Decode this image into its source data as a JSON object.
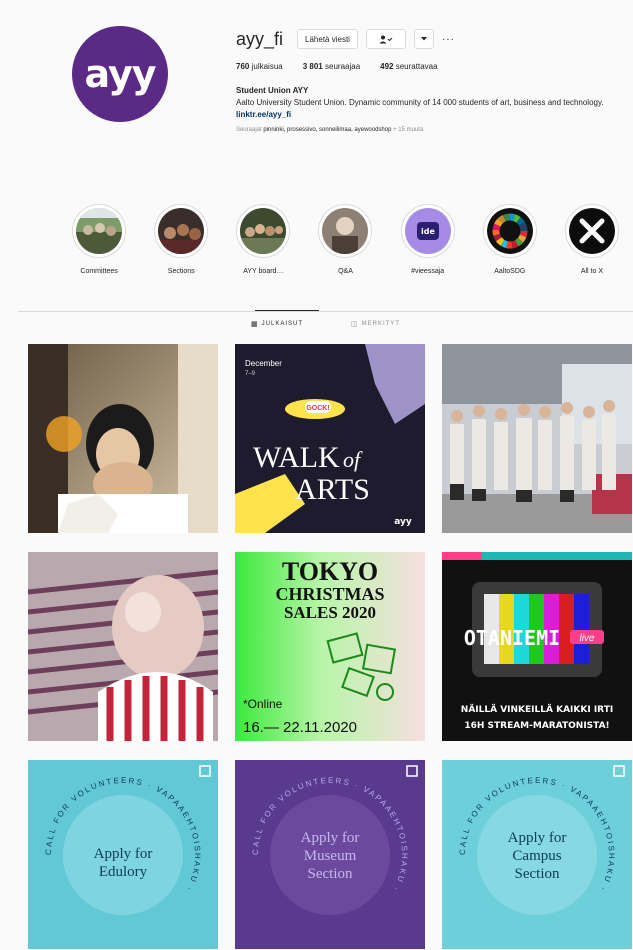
{
  "profile": {
    "username": "ayy_fi",
    "avatar_text": "ayy",
    "message_button": "Lähetä viesti",
    "follow_icon": "person-check-icon",
    "dropdown_icon": "chevron-down-icon",
    "more_icon": "ellipsis-icon",
    "more_label": "···",
    "stats": [
      {
        "value": "760",
        "label": "julkaisua"
      },
      {
        "value": "3 801",
        "label": "seuraajaa"
      },
      {
        "value": "492",
        "label": "seurattavaa"
      }
    ],
    "full_name": "Student Union AYY",
    "bio": "Aalto University Student Union. Dynamic community of 14 000 students of art, business and technology.",
    "link": "linktr.ee/ayy_fi",
    "followed_by_prefix": "Seuraajat",
    "followed_by_names": "pinninki, prosessivo, sonneilimaa, ayewoodshop",
    "followed_by_suffix": "+ 15 muuta"
  },
  "highlights": [
    {
      "label": "Committees"
    },
    {
      "label": "Sections"
    },
    {
      "label": "AYY board…"
    },
    {
      "label": "Q&A"
    },
    {
      "label": "#vieessaja",
      "badge": "ide"
    },
    {
      "label": "AaltoSDG"
    },
    {
      "label": "All to X"
    }
  ],
  "tabs": [
    {
      "label": "JULKAISUT",
      "icon": "grid-icon",
      "active": true
    },
    {
      "label": "MERKITYT",
      "icon": "tag-icon",
      "active": false
    }
  ],
  "posts": {
    "p2": {
      "month": "December",
      "day": "7–9",
      "badge": "GOCK!",
      "title1": "WALK",
      "title2": "of",
      "title3": "ARTS",
      "logo": "ayy"
    },
    "p5": {
      "line1": "TOKYO",
      "line2": "CHRISTMAS",
      "line3": "SALES 2020",
      "online": "*Online",
      "dates": "16.— 22.11.2020"
    },
    "p6": {
      "brand": "OTANIEMI",
      "live": "live",
      "line1": "NÄILLÄ VINKEILLÄ KAIKKI IRTI",
      "line2": "16H STREAM-MARATONISTA!"
    },
    "p7": {
      "l1": "Apply for",
      "l2": "Edulory",
      "ring": "CALL FOR VOLUNTEERS · VAPAAEHTOISHAKU · "
    },
    "p8": {
      "l1": "Apply for",
      "l2": "Museum",
      "l3": "Section",
      "ring": "CALL FOR VOLUNTEERS · VAPAAEHTOISHAKU · "
    },
    "p9": {
      "l1": "Apply for",
      "l2": "Campus",
      "l3": "Section",
      "ring": "CALL FOR VOLUNTEERS · VAPAAEHTOISHAKU · "
    }
  }
}
